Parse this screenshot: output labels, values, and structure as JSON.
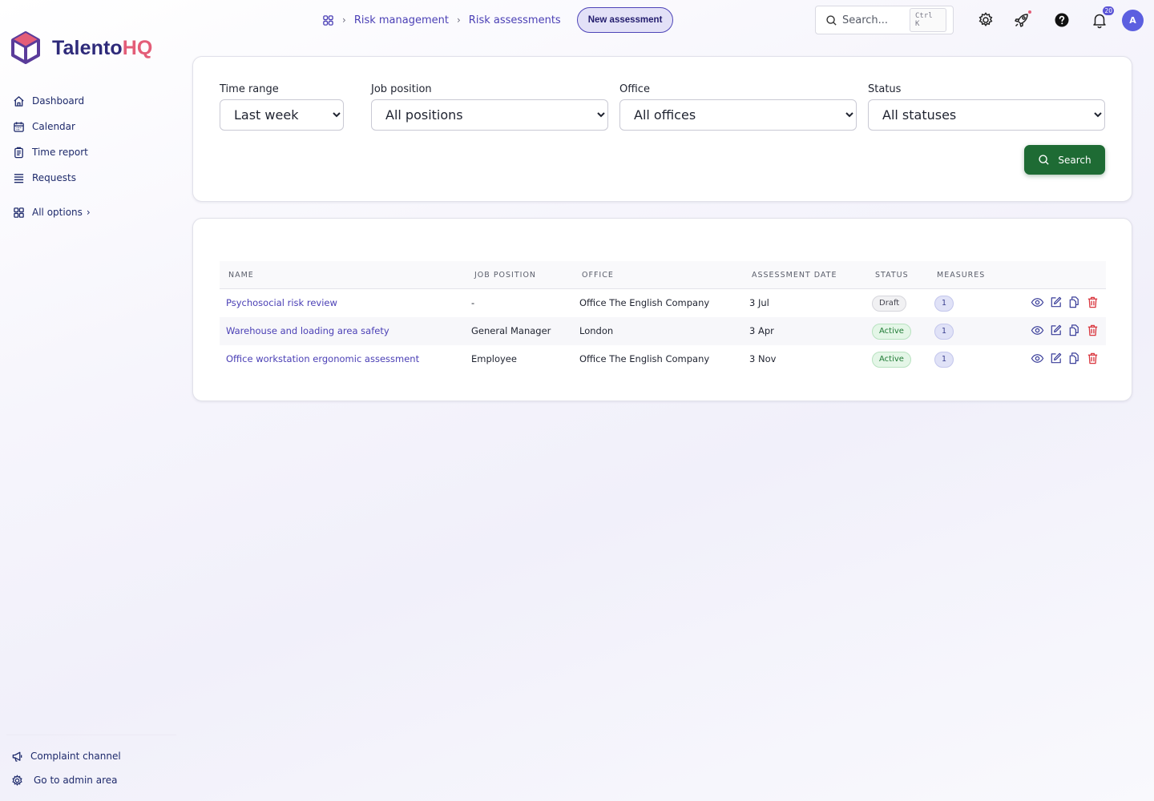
{
  "brand": {
    "name_main": "Talento",
    "name_accent": "HQ"
  },
  "sidebar": {
    "items": [
      {
        "label": "Dashboard",
        "icon": "home-icon"
      },
      {
        "label": "Calendar",
        "icon": "calendar-icon"
      },
      {
        "label": "Time report",
        "icon": "clipboard-icon"
      },
      {
        "label": "Requests",
        "icon": "list-icon"
      }
    ],
    "all_options": {
      "label": "All options",
      "icon": "grid-icon"
    },
    "bottom": [
      {
        "label": "Complaint channel",
        "icon": "megaphone-icon"
      },
      {
        "label": "Go to admin area",
        "icon": "gear-icon"
      }
    ]
  },
  "header": {
    "breadcrumb": [
      "Risk management",
      "Risk assessments"
    ],
    "new_button": "New assessment",
    "search_placeholder": "Search...",
    "search_shortcut": "Ctrl K",
    "notifications_count": "20",
    "avatar_initial": "A"
  },
  "filters": {
    "time_range": {
      "label": "Time range",
      "value": "Last week"
    },
    "job_position": {
      "label": "Job position",
      "value": "All positions"
    },
    "office": {
      "label": "Office",
      "value": "All offices"
    },
    "status": {
      "label": "Status",
      "value": "All statuses"
    },
    "search_button": "Search"
  },
  "table": {
    "columns": [
      "Name",
      "Job position",
      "Office",
      "Assessment date",
      "Status",
      "Measures"
    ],
    "rows": [
      {
        "name": "Psychosocial risk review",
        "position": "-",
        "office": "Office The English Company",
        "date": "3 Jul",
        "status": "Draft",
        "measures": "1"
      },
      {
        "name": "Warehouse and loading area safety",
        "position": "General Manager",
        "office": "London",
        "date": "3 Apr",
        "status": "Active",
        "measures": "1"
      },
      {
        "name": "Office workstation ergonomic assessment",
        "position": "Employee",
        "office": "Office The English Company",
        "date": "3 Nov",
        "status": "Active",
        "measures": "1"
      }
    ]
  },
  "colors": {
    "brand_indigo": "#2e2a7a",
    "brand_pink": "#e35d78",
    "link": "#4a3fb5",
    "search_button": "#1e6b34",
    "delete": "#d9363e"
  }
}
